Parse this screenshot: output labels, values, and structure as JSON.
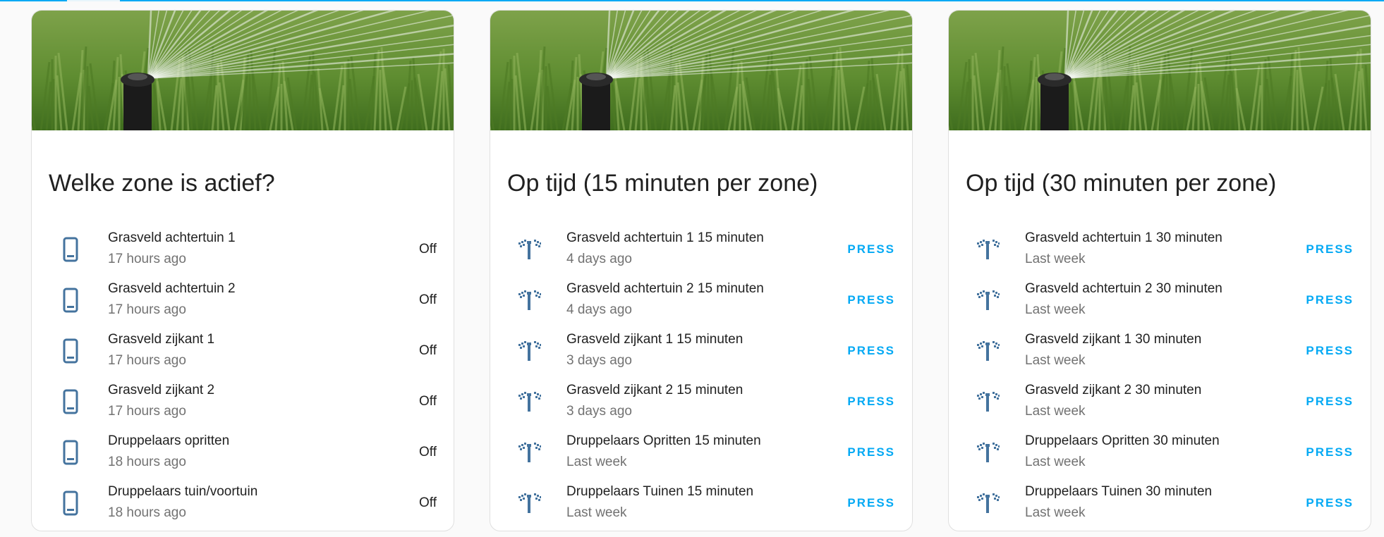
{
  "colors": {
    "accent": "#03a9f4",
    "icon": "#44739e"
  },
  "cards": [
    {
      "title": "Welke zone is actief?",
      "rows": [
        {
          "name": "Grasveld achtertuin 1",
          "sub": "17 hours ago",
          "state": "Off",
          "icon": "phone-icon"
        },
        {
          "name": "Grasveld achtertuin 2",
          "sub": "17 hours ago",
          "state": "Off",
          "icon": "phone-icon"
        },
        {
          "name": "Grasveld zijkant 1",
          "sub": "17 hours ago",
          "state": "Off",
          "icon": "phone-icon"
        },
        {
          "name": "Grasveld zijkant 2",
          "sub": "17 hours ago",
          "state": "Off",
          "icon": "phone-icon"
        },
        {
          "name": "Druppelaars opritten",
          "sub": "18 hours ago",
          "state": "Off",
          "icon": "phone-icon"
        },
        {
          "name": "Druppelaars tuin/voortuin",
          "sub": "18 hours ago",
          "state": "Off",
          "icon": "phone-icon"
        }
      ]
    },
    {
      "title": "Op tijd (15 minuten per zone)",
      "rows": [
        {
          "name": "Grasveld achtertuin 1 15 minuten",
          "sub": "4 days ago",
          "action": "PRESS",
          "icon": "sprinkler-icon"
        },
        {
          "name": "Grasveld achtertuin 2 15 minuten",
          "sub": "4 days ago",
          "action": "PRESS",
          "icon": "sprinkler-icon"
        },
        {
          "name": "Grasveld zijkant 1 15 minuten",
          "sub": "3 days ago",
          "action": "PRESS",
          "icon": "sprinkler-icon"
        },
        {
          "name": "Grasveld zijkant 2 15 minuten",
          "sub": "3 days ago",
          "action": "PRESS",
          "icon": "sprinkler-icon"
        },
        {
          "name": "Druppelaars Opritten 15 minuten",
          "sub": "Last week",
          "action": "PRESS",
          "icon": "sprinkler-icon"
        },
        {
          "name": "Druppelaars Tuinen 15 minuten",
          "sub": "Last week",
          "action": "PRESS",
          "icon": "sprinkler-icon"
        }
      ]
    },
    {
      "title": "Op tijd (30 minuten per zone)",
      "rows": [
        {
          "name": "Grasveld achtertuin 1 30 minuten",
          "sub": "Last week",
          "action": "PRESS",
          "icon": "sprinkler-icon"
        },
        {
          "name": "Grasveld achtertuin 2 30 minuten",
          "sub": "Last week",
          "action": "PRESS",
          "icon": "sprinkler-icon"
        },
        {
          "name": "Grasveld zijkant 1 30 minuten",
          "sub": "Last week",
          "action": "PRESS",
          "icon": "sprinkler-icon"
        },
        {
          "name": "Grasveld zijkant 2 30 minuten",
          "sub": "Last week",
          "action": "PRESS",
          "icon": "sprinkler-icon"
        },
        {
          "name": "Druppelaars Opritten 30 minuten",
          "sub": "Last week",
          "action": "PRESS",
          "icon": "sprinkler-icon"
        },
        {
          "name": "Druppelaars Tuinen 30 minuten",
          "sub": "Last week",
          "action": "PRESS",
          "icon": "sprinkler-icon"
        }
      ]
    }
  ]
}
